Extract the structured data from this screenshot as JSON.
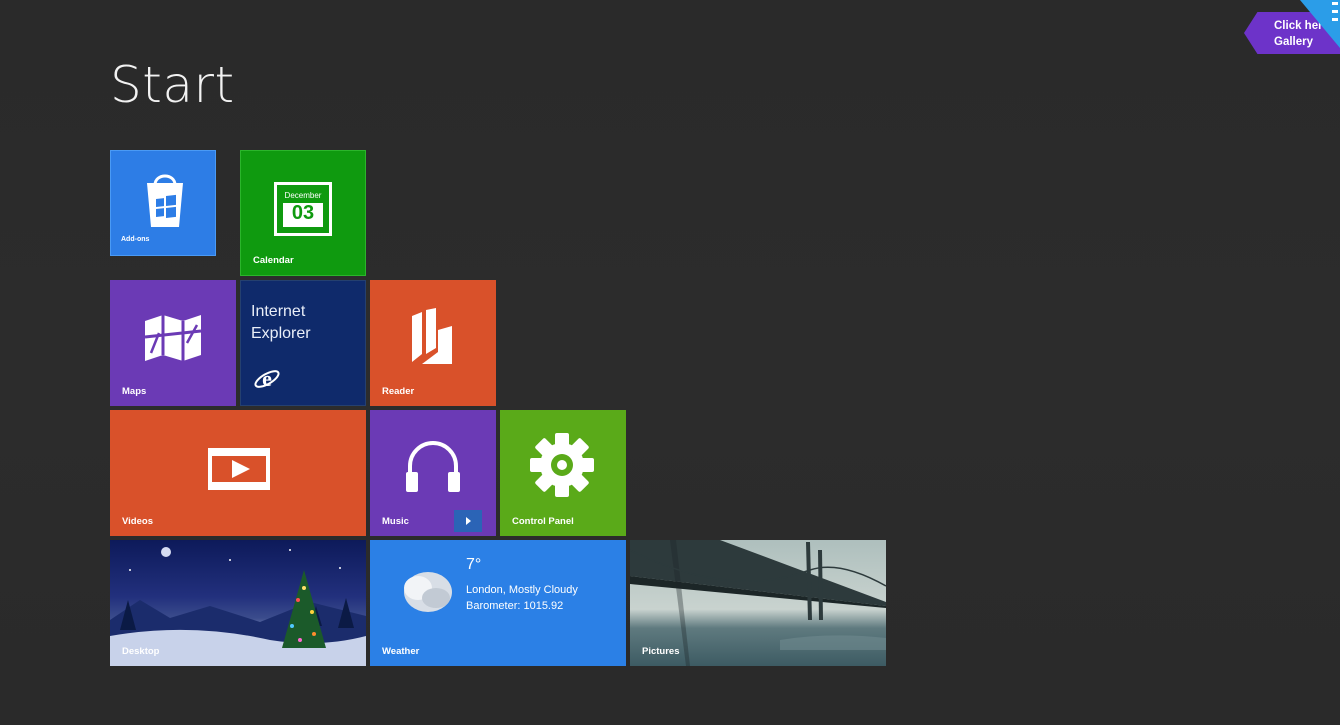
{
  "page": {
    "title": "Start"
  },
  "gallery": {
    "line1": "Click here",
    "line2": "Gallery"
  },
  "tiles": {
    "store": {
      "label": "Add-ons",
      "color": "#2d7de6",
      "icon": "store-bag-icon"
    },
    "calendar": {
      "label": "Calendar",
      "month": "December",
      "day": "03",
      "color": "#0f9a0f",
      "icon": "calendar-icon"
    },
    "maps": {
      "label": "Maps",
      "color": "#6b3ab5",
      "icon": "map-icon"
    },
    "ie": {
      "line1": "Internet",
      "line2": "Explorer",
      "color": "#0f2a6b",
      "icon": "internet-explorer-icon"
    },
    "reader": {
      "label": "Reader",
      "color": "#d9512a",
      "icon": "reader-icon"
    },
    "videos": {
      "label": "Videos",
      "color": "#d9512a",
      "icon": "video-play-icon"
    },
    "music": {
      "label": "Music",
      "color": "#6b3ab5",
      "icon": "headphones-icon"
    },
    "control_panel": {
      "label": "Control Panel",
      "color": "#5aaa19",
      "icon": "gear-icon"
    },
    "desktop": {
      "label": "Desktop",
      "icon": "desktop-wallpaper"
    },
    "weather": {
      "label": "Weather",
      "temp": "7°",
      "location": "London, Mostly Cloudy",
      "barometer": "Barometer: 1015.92",
      "color": "#2b80e6",
      "icon": "cloud-icon"
    },
    "pictures": {
      "label": "Pictures",
      "icon": "pictures-wallpaper"
    }
  }
}
